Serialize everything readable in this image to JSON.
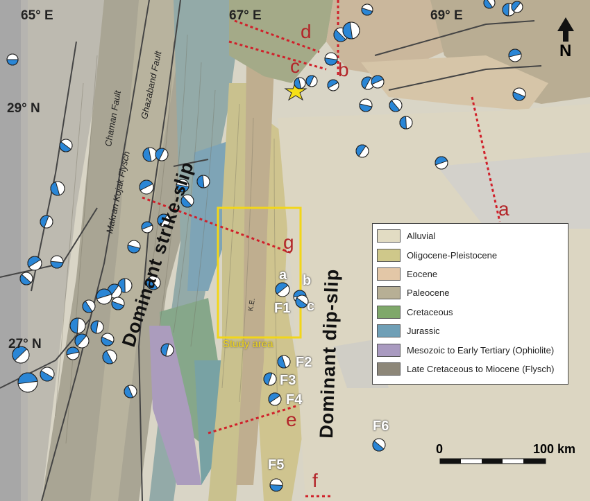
{
  "coords": {
    "lon_65": "65° E",
    "lon_67": "67° E",
    "lon_69": "69° E",
    "lat_29": "29° N",
    "lat_27": "27° N"
  },
  "faults": {
    "chaman": "Chaman Fault",
    "ghazaband": "Ghazaband Fault",
    "makran": "Makran Kojak Flysch"
  },
  "regimes": {
    "strike_slip": "Dominant strike-slip",
    "dip_slip": "Dominant dip-slip"
  },
  "profile_labels": [
    "a",
    "b",
    "c",
    "d",
    "e",
    "f",
    "g"
  ],
  "event_labels": {
    "a": "a",
    "b": "b",
    "c": "c",
    "F1": "F1",
    "F2": "F2",
    "F3": "F3",
    "F4": "F4",
    "F5": "F5",
    "F6": "F6"
  },
  "study_area": "Study area",
  "kc_label": "K.E.",
  "legend": [
    {
      "label": "Alluvial",
      "color": "#e2dcc3"
    },
    {
      "label": "Oligocene-Pleistocene",
      "color": "#cfc88a"
    },
    {
      "label": "Eocene",
      "color": "#e3c7a7"
    },
    {
      "label": "Paleocene",
      "color": "#b7af95"
    },
    {
      "label": "Cretaceous",
      "color": "#7fa86a"
    },
    {
      "label": "Jurassic",
      "color": "#6f9fb6"
    },
    {
      "label": "Mesozoic to Early Tertiary (Ophiolite)",
      "color": "#a99ac0"
    },
    {
      "label": "Late Cretaceous to Miocene (Flysch)",
      "color": "#8d8779"
    }
  ],
  "scale": {
    "start": "0",
    "end": "100 km"
  },
  "north": "N",
  "colors": {
    "profile_line": "#d0202a",
    "study_box": "#f2d619",
    "mechanism": "#2a86d6"
  }
}
